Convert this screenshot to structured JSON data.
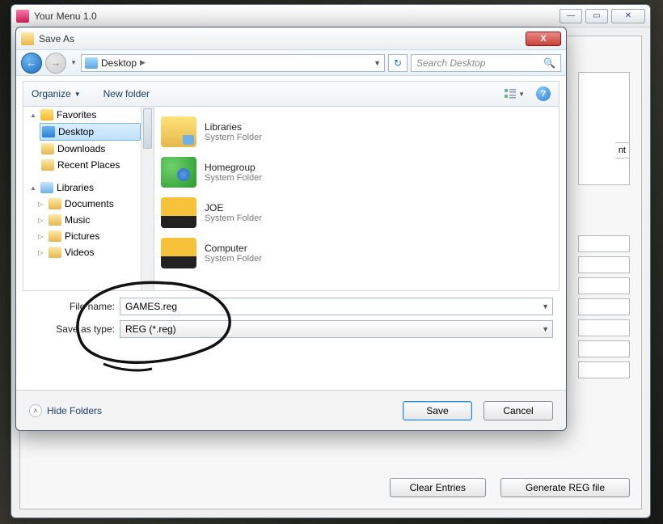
{
  "parent": {
    "title": "Your Menu 1.0",
    "right_tab": "nt",
    "buttons": {
      "clear": "Clear Entries",
      "generate": "Generate REG file"
    }
  },
  "dialog": {
    "title": "Save As",
    "breadcrumb": "Desktop",
    "search_placeholder": "Search Desktop",
    "toolbar": {
      "organize": "Organize",
      "newfolder": "New folder"
    },
    "tree": {
      "favorites": "Favorites",
      "desktop": "Desktop",
      "downloads": "Downloads",
      "recent": "Recent Places",
      "libraries": "Libraries",
      "documents": "Documents",
      "music": "Music",
      "pictures": "Pictures",
      "videos": "Videos"
    },
    "items": [
      {
        "title": "Libraries",
        "sub": "System Folder",
        "icon": "lib"
      },
      {
        "title": "Homegroup",
        "sub": "System Folder",
        "icon": "home"
      },
      {
        "title": "JOE",
        "sub": "System Folder",
        "icon": "car"
      },
      {
        "title": "Computer",
        "sub": "System Folder",
        "icon": "car"
      }
    ],
    "filename_label": "File name:",
    "filename_value": "GAMES.reg",
    "saveas_label": "Save as type:",
    "saveas_value": "REG (*.reg)",
    "hide_folders": "Hide Folders",
    "save": "Save",
    "cancel": "Cancel"
  }
}
